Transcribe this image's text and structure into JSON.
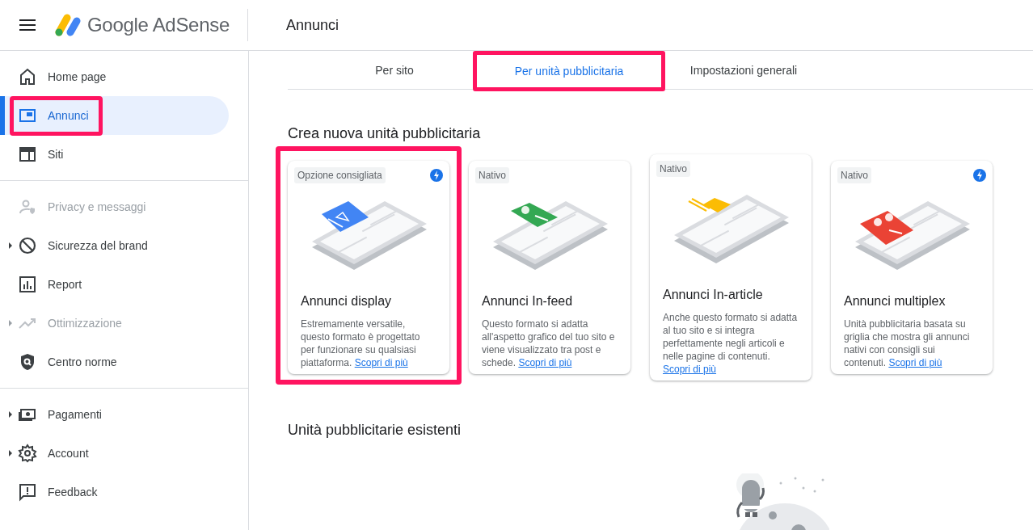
{
  "header": {
    "brand": "Google AdSense",
    "page_title": "Annunci"
  },
  "sidebar": {
    "groups": [
      {
        "items": [
          {
            "label": "Home page",
            "selected": false,
            "disabled": false,
            "expandable": false,
            "highlighted": false
          },
          {
            "label": "Annunci",
            "selected": true,
            "disabled": false,
            "expandable": false,
            "highlighted": true
          },
          {
            "label": "Siti",
            "selected": false,
            "disabled": false,
            "expandable": false,
            "highlighted": false
          }
        ]
      },
      {
        "items": [
          {
            "label": "Privacy e messaggi",
            "selected": false,
            "disabled": true,
            "expandable": false,
            "highlighted": false
          },
          {
            "label": "Sicurezza del brand",
            "selected": false,
            "disabled": false,
            "expandable": true,
            "highlighted": false
          },
          {
            "label": "Report",
            "selected": false,
            "disabled": false,
            "expandable": false,
            "highlighted": false
          },
          {
            "label": "Ottimizzazione",
            "selected": false,
            "disabled": true,
            "expandable": true,
            "highlighted": false
          },
          {
            "label": "Centro norme",
            "selected": false,
            "disabled": false,
            "expandable": false,
            "highlighted": false
          }
        ]
      },
      {
        "items": [
          {
            "label": "Pagamenti",
            "selected": false,
            "disabled": false,
            "expandable": true,
            "highlighted": false
          },
          {
            "label": "Account",
            "selected": false,
            "disabled": false,
            "expandable": true,
            "highlighted": false
          },
          {
            "label": "Feedback",
            "selected": false,
            "disabled": false,
            "expandable": false,
            "highlighted": false
          }
        ]
      }
    ]
  },
  "tabs": [
    {
      "label": "Per sito",
      "selected": false,
      "highlighted": false
    },
    {
      "label": "Per unità pubblicitaria",
      "selected": true,
      "highlighted": true
    },
    {
      "label": "Impostazioni generali",
      "selected": false,
      "highlighted": false
    }
  ],
  "create_section": {
    "title": "Crea nuova unità pubblicitaria",
    "cards": [
      {
        "kind": "display",
        "tag": "Opzione consigliata",
        "flash": true,
        "raised": false,
        "highlighted": true,
        "title": "Annunci display",
        "description": "Estremamente versatile, questo formato è progettato per funzionare su qualsiasi piattaforma.",
        "link": "Scopri di più"
      },
      {
        "kind": "infeed",
        "tag": "Nativo",
        "flash": false,
        "raised": false,
        "highlighted": false,
        "title": "Annunci In-feed",
        "description": "Questo formato si adatta all'aspetto grafico del tuo sito e viene visualizzato tra post e schede.",
        "link": "Scopri di più"
      },
      {
        "kind": "inarticle",
        "tag": "Nativo",
        "flash": false,
        "raised": true,
        "highlighted": false,
        "title": "Annunci In-article",
        "description": "Anche questo formato si adatta al tuo sito e si integra perfettamente negli articoli e nelle pagine di contenuti.",
        "link": "Scopri di più"
      },
      {
        "kind": "multiplex",
        "tag": "Nativo",
        "flash": true,
        "raised": false,
        "highlighted": false,
        "title": "Annunci multiplex",
        "description": "Unità pubblicitaria basata su griglia che mostra gli annunci nativi con consigli sui contenuti.",
        "link": "Scopri di più"
      }
    ]
  },
  "existing_section": {
    "title": "Unità pubblicitarie esistenti"
  }
}
